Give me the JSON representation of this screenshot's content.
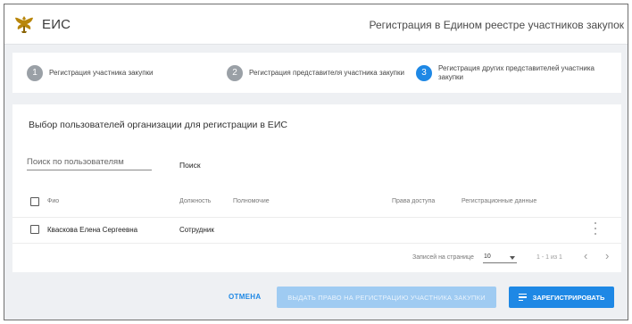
{
  "header": {
    "brand": "ЕИС",
    "title": "Регистрация в Едином реестре участников закупок"
  },
  "stepper": [
    {
      "number": "1",
      "label": "Регистрация участника закупки"
    },
    {
      "number": "2",
      "label": "Регистрация представителя участника закупки"
    },
    {
      "number": "3",
      "label": "Регистрация других представителей участника закупки"
    }
  ],
  "main": {
    "title": "Выбор пользователей организации для регистрации в ЕИС",
    "search": {
      "placeholder": "Поиск по пользователям",
      "button": "Поиск"
    },
    "columns": {
      "fio": "Фио",
      "position": "Должность",
      "authority": "Полномочие",
      "access": "Права доступа",
      "reg_data": "Регистрационные данные"
    },
    "rows": [
      {
        "fio": "Кваскова Елена Сергеевна",
        "position": "Сотрудник",
        "authority": "",
        "access": "",
        "reg_data": ""
      }
    ],
    "pager": {
      "per_page_label": "Записей на странице",
      "per_page_value": "10",
      "range": "1 - 1 из 1"
    }
  },
  "footer": {
    "cancel": "ОТМЕНА",
    "grant": "ВЫДАТЬ ПРАВО НА РЕГИСТРАЦИЮ УЧАСТНИКА ЗАКУПКИ",
    "register": "ЗАРЕГИСТРИРОВАТЬ"
  },
  "colors": {
    "accent": "#1e88e5",
    "disabled_button": "#9fcbf2",
    "background": "#eef0f3",
    "logo_gold": "#b8860b"
  },
  "icons": [
    "eagle-emblem-icon",
    "more-vert-icon",
    "chevron-down-icon",
    "chevron-left-icon",
    "chevron-right-icon",
    "checklist-icon"
  ]
}
